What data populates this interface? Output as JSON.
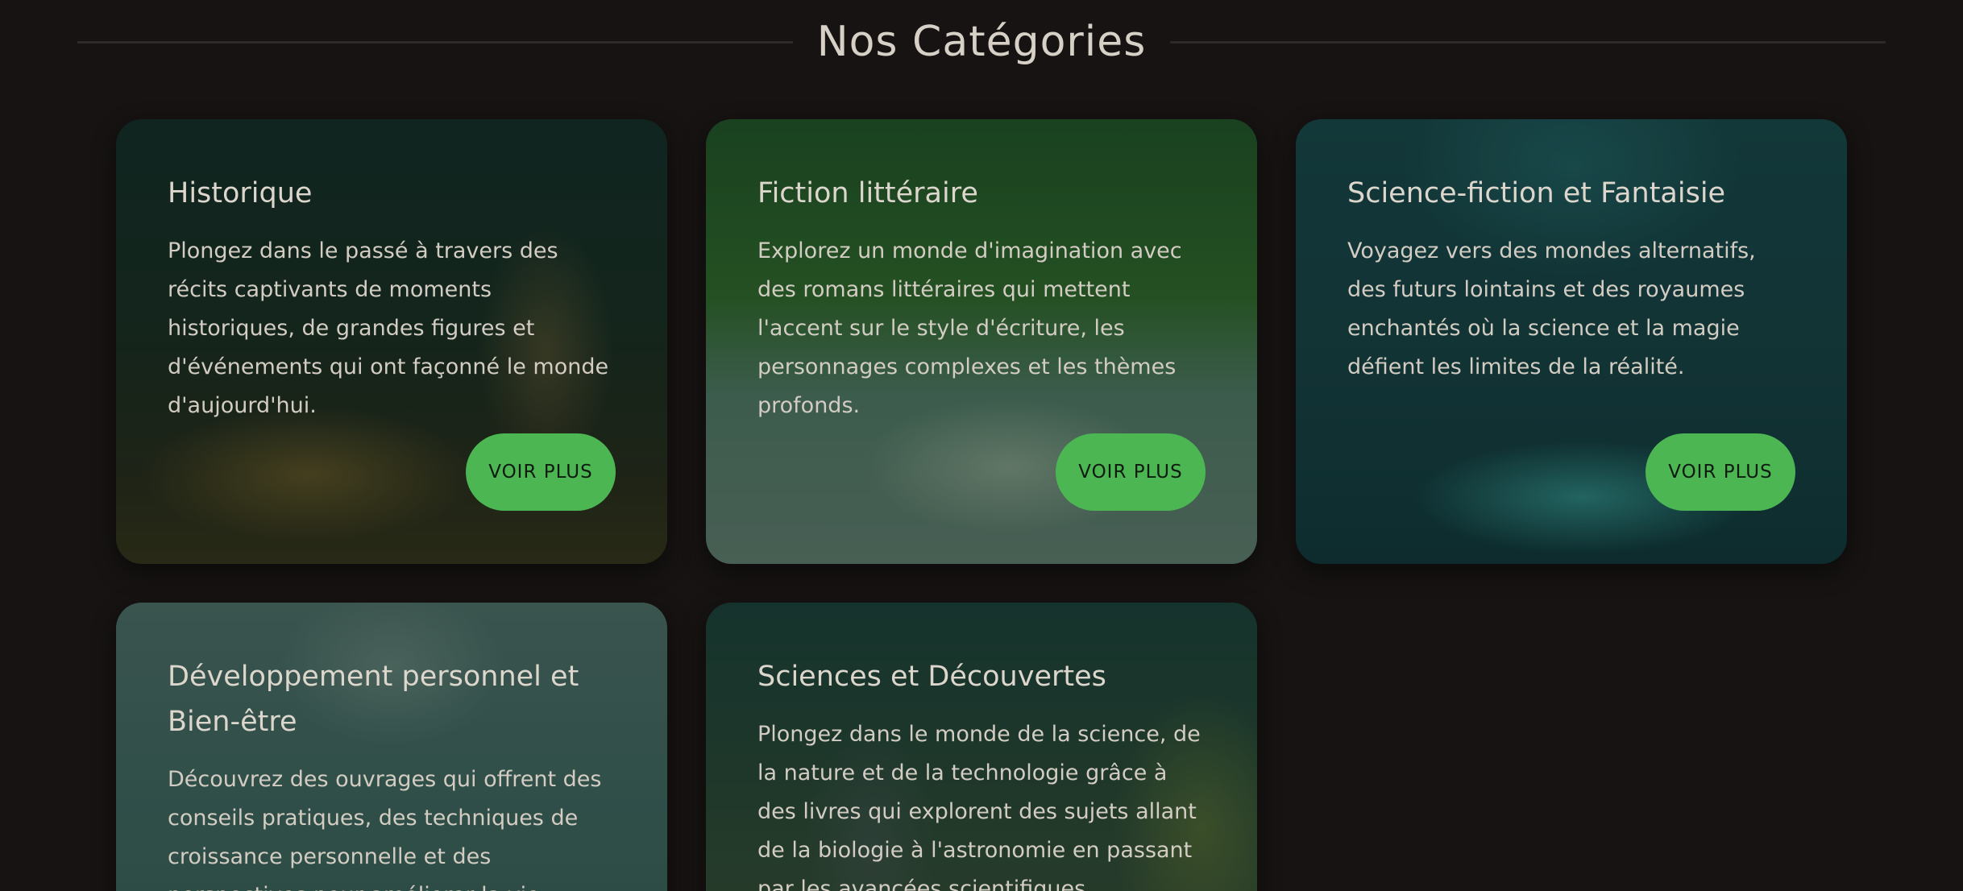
{
  "section": {
    "title": "Nos Catégories"
  },
  "accent_color": "#4cb653",
  "categories": [
    {
      "title": "Historique",
      "description": "Plongez dans le passé à travers des récits captivants de moments historiques, de grandes figures et d'événements qui ont façonné le monde d'aujourd'hui.",
      "button_label": "VOIR PLUS"
    },
    {
      "title": "Fiction littéraire",
      "description": "Explorez un monde d'imagination avec des romans littéraires qui mettent l'accent sur le style d'écriture, les personnages complexes et les thèmes profonds.",
      "button_label": "VOIR PLUS"
    },
    {
      "title": "Science-fiction et Fantaisie",
      "description": "Voyagez vers des mondes alternatifs, des futurs lointains et des royaumes enchantés où la science et la magie défient les limites de la réalité.",
      "button_label": "VOIR PLUS"
    },
    {
      "title": "Développement personnel et Bien-être",
      "description": "Découvrez des ouvrages qui offrent des conseils pratiques, des techniques de croissance personnelle et des perspectives pour améliorer la vie"
    },
    {
      "title": "Sciences et Découvertes",
      "description": "Plongez dans le monde de la science, de la nature et de la technologie grâce à des livres qui explorent des sujets allant de la biologie à l'astronomie en passant par les avancées scientifiques."
    }
  ]
}
